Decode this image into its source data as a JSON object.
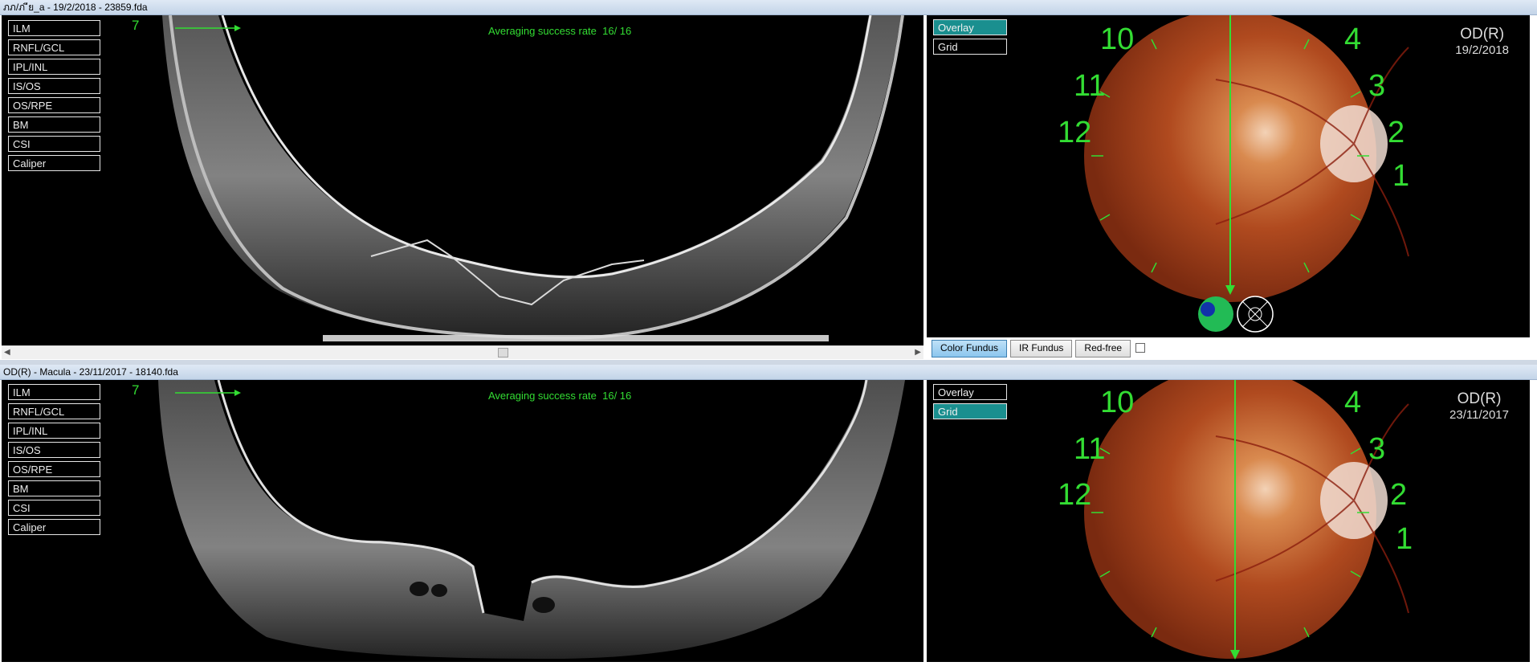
{
  "top": {
    "title": "ภภ/ภ  ีย_a - 19/2/2018 - 23859.fda",
    "layers": [
      "ILM",
      "RNFL/GCL",
      "IPL/INL",
      "IS/OS",
      "OS/RPE",
      "BM",
      "CSI",
      "Caliper"
    ],
    "scan_number": "7",
    "averaging_label": "Averaging success rate",
    "averaging_value": "16/ 16",
    "overlay_label": "Overlay",
    "grid_label": "Grid",
    "active_mode": "Overlay",
    "eye": "OD(R)",
    "date": "19/2/2018",
    "clock_numbers": [
      "10",
      "11",
      "12",
      "4",
      "3",
      "2",
      "1"
    ]
  },
  "bottom": {
    "title": "OD(R) - Macula - 23/11/2017 - 18140.fda",
    "layers": [
      "ILM",
      "RNFL/GCL",
      "IPL/INL",
      "IS/OS",
      "OS/RPE",
      "BM",
      "CSI",
      "Caliper"
    ],
    "scan_number": "7",
    "averaging_label": "Averaging success rate",
    "averaging_value": "16/ 16",
    "overlay_label": "Overlay",
    "grid_label": "Grid",
    "active_mode": "Grid",
    "eye": "OD(R)",
    "date": "23/11/2017",
    "clock_numbers": [
      "10",
      "11",
      "12",
      "4",
      "3",
      "2",
      "1"
    ]
  },
  "fundus_tabs": [
    "Color Fundus",
    "IR Fundus",
    "Red-free"
  ],
  "active_fundus_tab": "Color Fundus",
  "colors": {
    "accent_green": "#33dd33",
    "active_teal": "#1a8f8f"
  }
}
